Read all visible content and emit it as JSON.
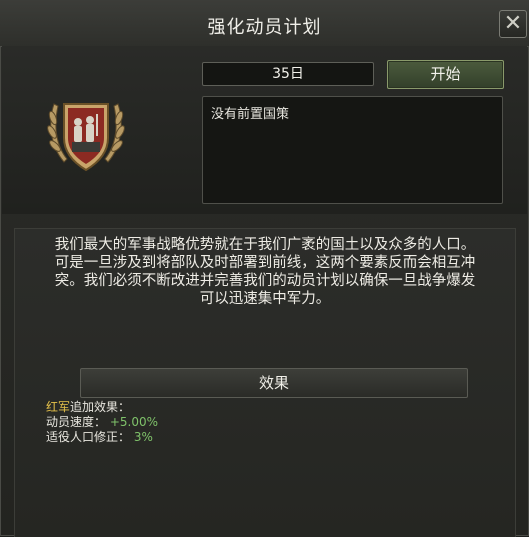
{
  "window": {
    "title": "强化动员计划",
    "close_symbol": "✕"
  },
  "focus": {
    "duration": "35日",
    "start_label": "开始",
    "prerequisite_text": "没有前置国策",
    "emblem_icon": "national-focus-mobilization-emblem",
    "description": [
      "我们最大的军事战略优势就在于我们广袤的国土以及众多的人口。",
      "可是一旦涉及到将部队及时部署到前线，这两个要素反而会相互冲",
      "突。我们必须不断改进并完善我们的动员计划以确保一旦战争爆发",
      "可以迅速集中军力。"
    ]
  },
  "effects": {
    "header_label": "效果",
    "country_name": "红军",
    "country_suffix": "追加效果：",
    "mobilization_label": "动员速度：",
    "mobilization_value": "+5.00%",
    "manpower_label": "适役人口修正：",
    "manpower_value": "3%"
  },
  "colors": {
    "accent_green": "#7fc26a",
    "country_yellow": "#e4c04a"
  }
}
